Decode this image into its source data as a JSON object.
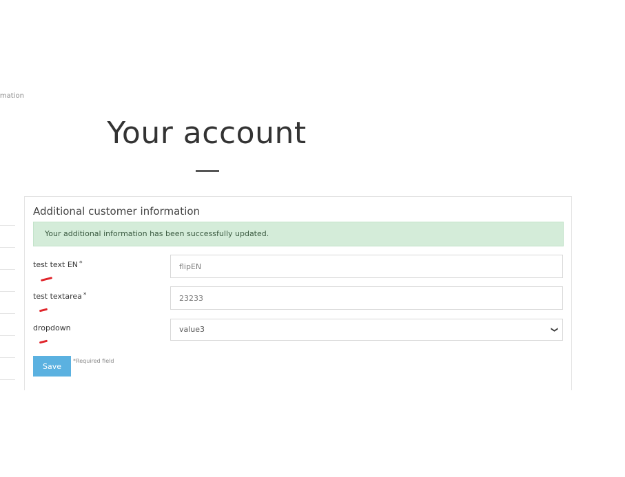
{
  "breadcrumb": {
    "current": "rmation"
  },
  "page": {
    "title": "Your account"
  },
  "panel": {
    "heading": "Additional customer information",
    "alert": {
      "message": "Your additional information has been successfully updated.",
      "color": "#d4ecd9"
    }
  },
  "form": {
    "fields": [
      {
        "label": "test text EN",
        "required_mark": "*",
        "value": "flipEN"
      },
      {
        "label": "test textarea",
        "required_mark": "*",
        "value": "23233"
      },
      {
        "label": "dropdown",
        "selected": "value3"
      }
    ],
    "save_label": "Save",
    "required_note": "*Required field",
    "save_color": "#5bb1e0"
  },
  "annotations": {
    "marker_color": "#e0242a"
  }
}
